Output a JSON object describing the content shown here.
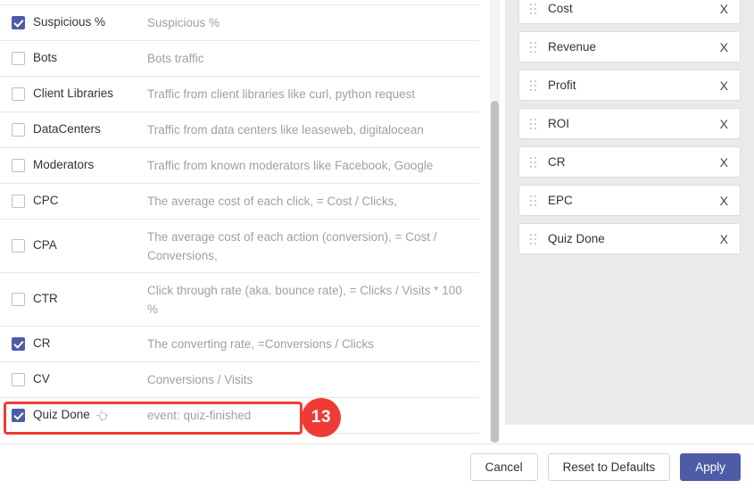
{
  "available_columns": {
    "rows": [
      {
        "name": "Suspicious %",
        "desc": "Suspicious %",
        "checked": true,
        "tall": false,
        "icon": null
      },
      {
        "name": "Bots",
        "desc": "Bots traffic",
        "checked": false,
        "tall": false,
        "icon": null
      },
      {
        "name": "Client Libraries",
        "desc": "Traffic from client libraries like curl, python request",
        "checked": false,
        "tall": false,
        "icon": null
      },
      {
        "name": "DataCenters",
        "desc": "Traffic from data centers like leaseweb, digitalocean",
        "checked": false,
        "tall": false,
        "icon": null
      },
      {
        "name": "Moderators",
        "desc": "Traffic from known moderators like Facebook, Google",
        "checked": false,
        "tall": false,
        "icon": null
      },
      {
        "name": "CPC",
        "desc": "The average cost of each click, = Cost / Clicks,",
        "checked": false,
        "tall": false,
        "icon": null
      },
      {
        "name": "CPA",
        "desc": "The average cost of each action (conversion), = Cost / Conversions,",
        "checked": false,
        "tall": true,
        "icon": null
      },
      {
        "name": "CTR",
        "desc": "Click through rate (aka. bounce rate), = Clicks / Visits * 100 %",
        "checked": false,
        "tall": true,
        "icon": null
      },
      {
        "name": "CR",
        "desc": "The converting rate, =Conversions / Clicks",
        "checked": true,
        "tall": false,
        "icon": null
      },
      {
        "name": "CV",
        "desc": "Conversions / Visits",
        "checked": false,
        "tall": false,
        "icon": null
      },
      {
        "name": "Quiz Done",
        "desc": "event: quiz-finished",
        "checked": true,
        "tall": false,
        "icon": "target-icon"
      }
    ]
  },
  "selected_columns": {
    "remove_label": "X",
    "items": [
      {
        "label": "Cost"
      },
      {
        "label": "Revenue"
      },
      {
        "label": "Profit"
      },
      {
        "label": "ROI"
      },
      {
        "label": "CR"
      },
      {
        "label": "EPC"
      },
      {
        "label": "Quiz Done"
      }
    ]
  },
  "annotation": {
    "step_badge": "13",
    "highlight_color": "#ef3b36"
  },
  "footer": {
    "cancel_label": "Cancel",
    "reset_label": "Reset to Defaults",
    "apply_label": "Apply"
  },
  "theme": {
    "accent": "#4e5ba6",
    "panel_bg": "#e8eaec",
    "muted_text": "#a0a0a0"
  }
}
